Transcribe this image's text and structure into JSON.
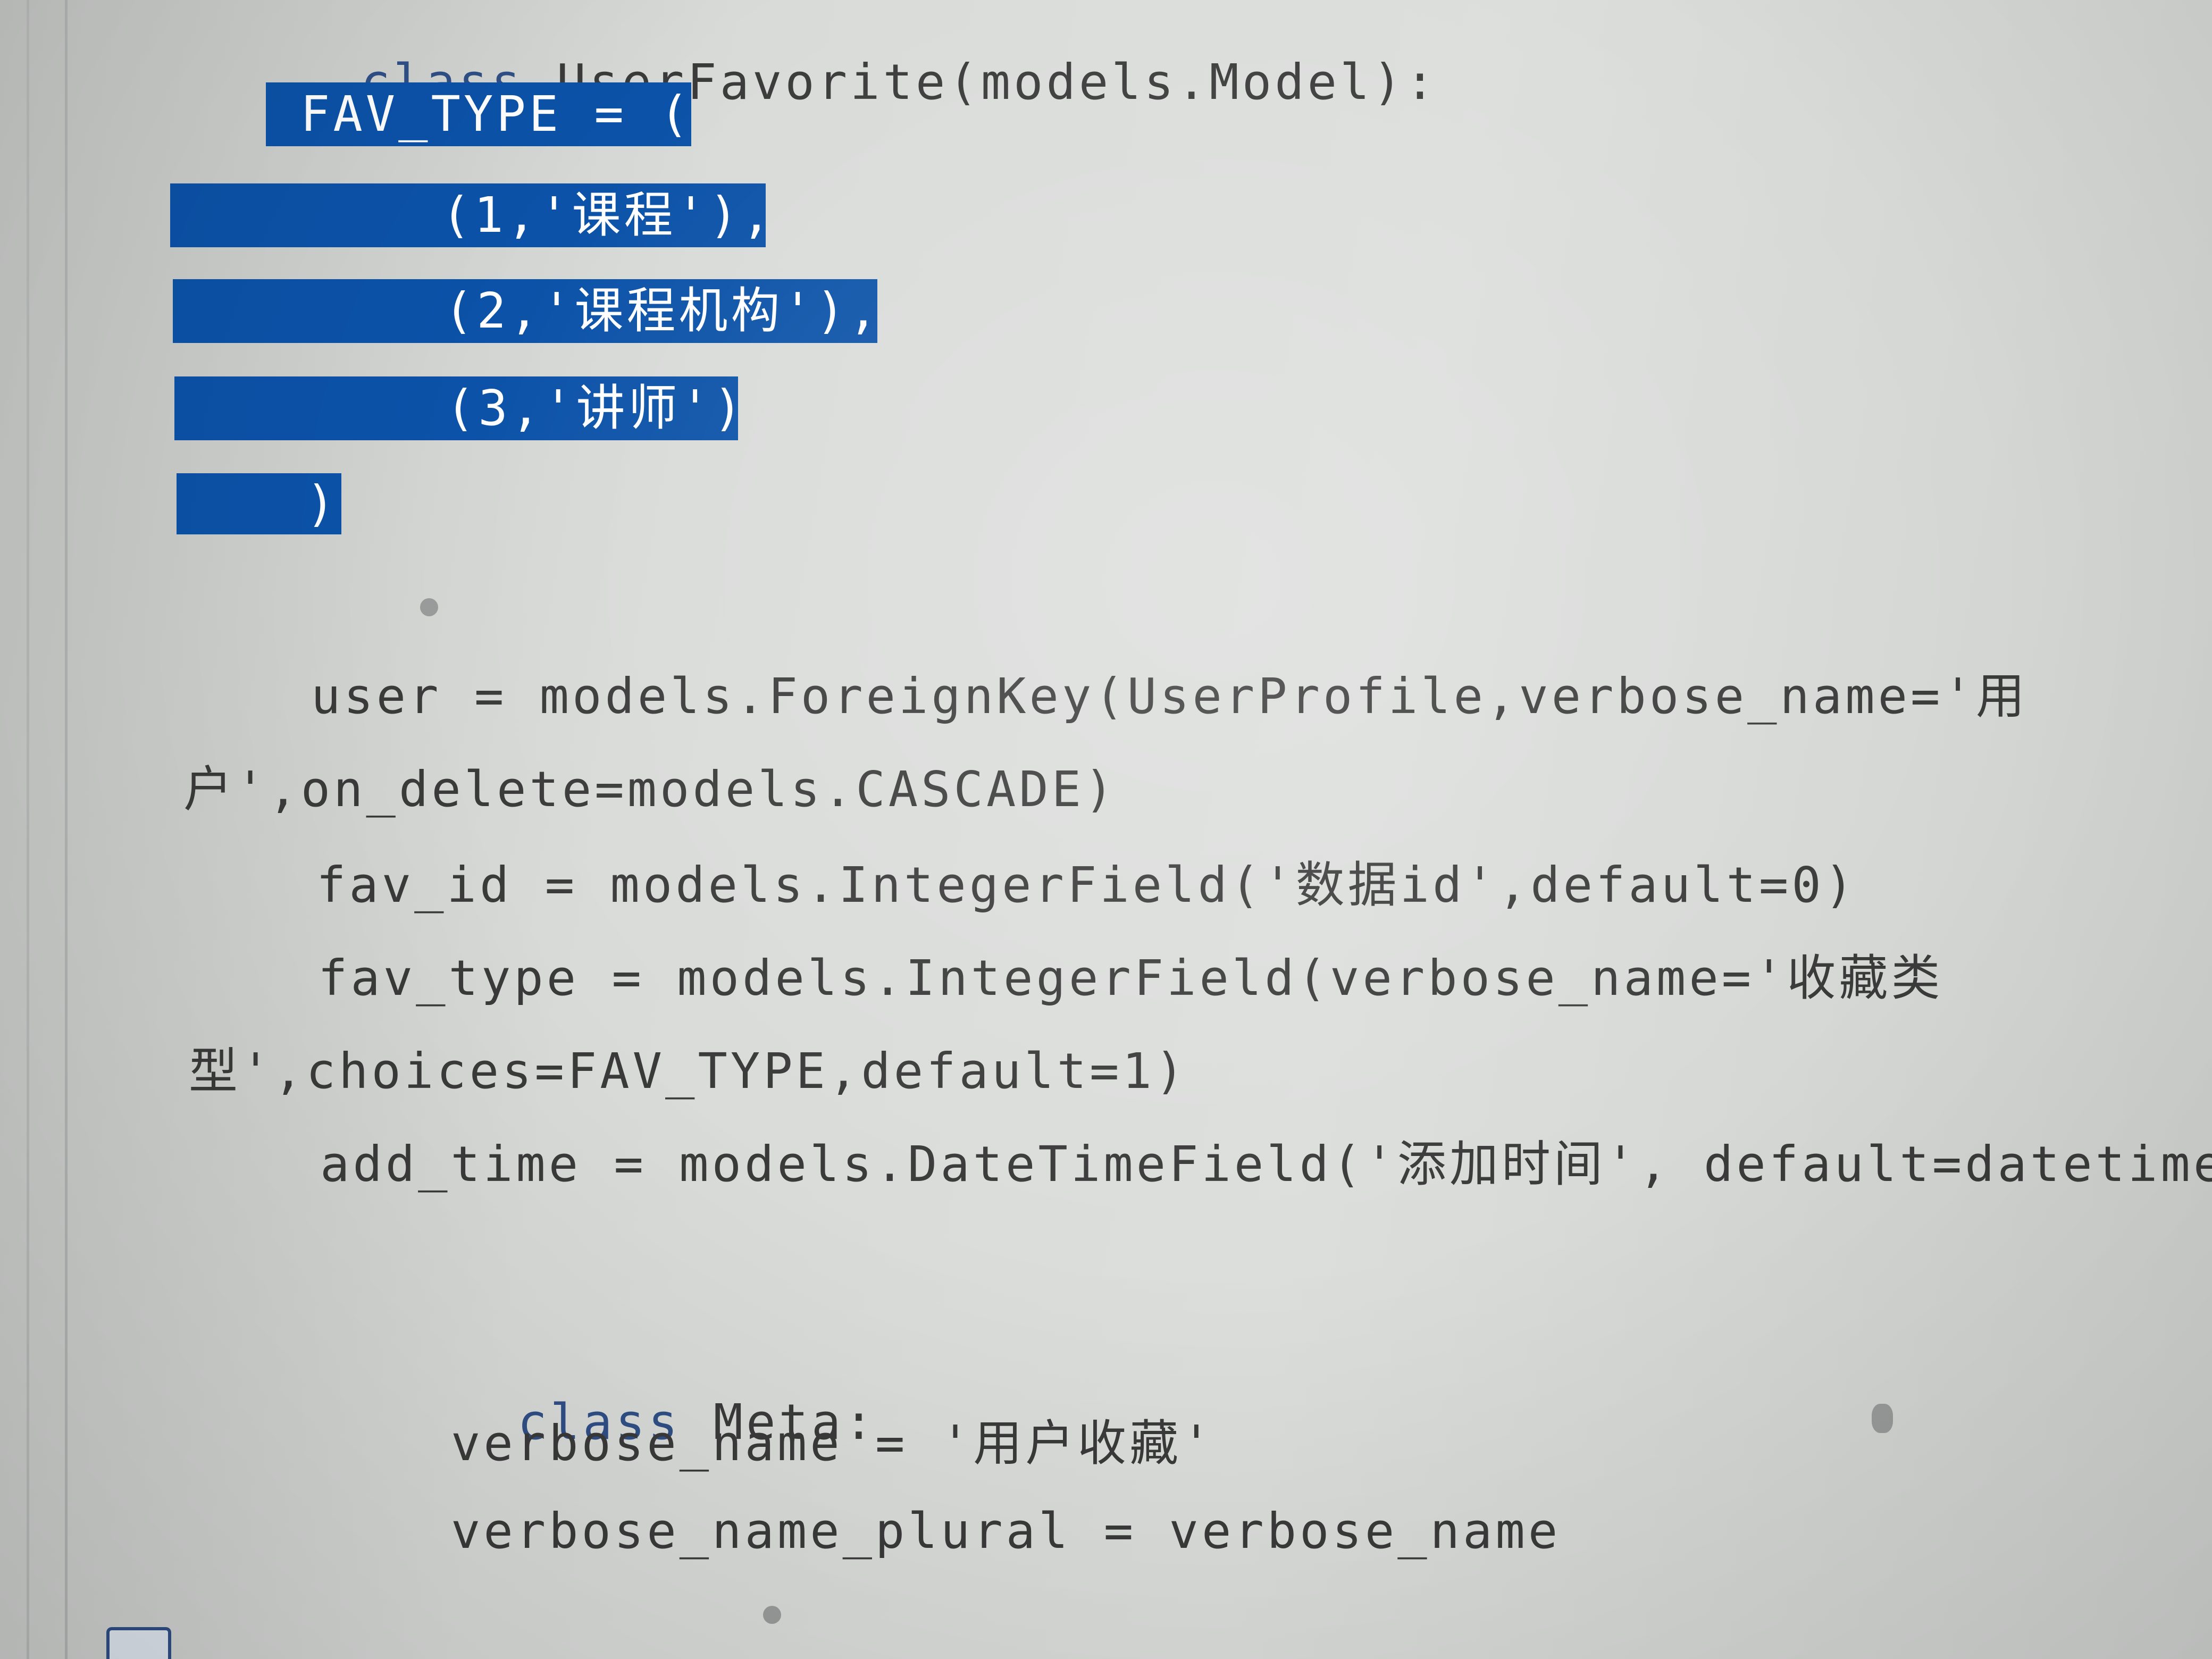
{
  "editor": {
    "lines": {
      "class_decl": {
        "keyword": "class",
        "rest": " UserFavorite(models.Model):"
      },
      "fav_type_open": "FAV_TYPE = (",
      "fav_type_item1": "(1,'课程'),",
      "fav_type_item2": "(2,'课程机构'),",
      "fav_type_item3": "(3,'讲师')",
      "fav_type_close": ")",
      "user_line_a": "user = models.ForeignKey(UserProfile,verbose_name='用",
      "user_line_b": "户',on_delete=models.CASCADE)",
      "fav_id_line": "fav_id = models.IntegerField('数据id',default=0)",
      "fav_type_line_a": "fav_type = models.IntegerField(verbose_name='收藏类",
      "fav_type_line_b": "型',choices=FAV_TYPE,default=1)",
      "add_time_line": "add_time = models.DateTimeField('添加时间', default=datetime.no",
      "meta_decl": {
        "keyword": "class",
        "rest": " Meta:"
      },
      "verbose_name_line": "verbose_name = '用户收藏'",
      "verbose_plural_line": "verbose_name_plural = verbose_name"
    },
    "colors": {
      "selection": "#0b52a8",
      "keyword": "#2f4f86",
      "text": "#3a3a3a",
      "background": "#d9dbd9"
    }
  }
}
